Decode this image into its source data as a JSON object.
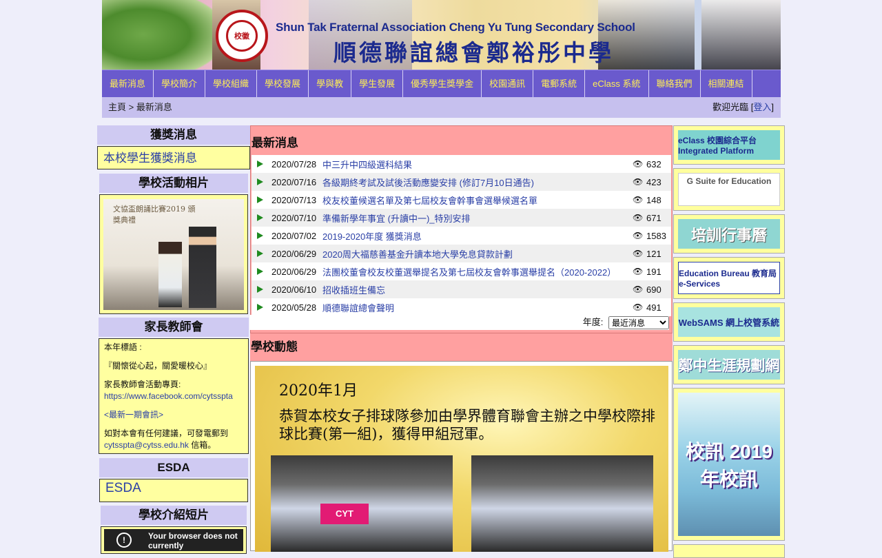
{
  "banner": {
    "title_en": "Shun Tak Fraternal Association Cheng Yu Tung Secondary School",
    "title_zh": "順德聯誼總會鄭裕彤中學"
  },
  "nav": [
    "最新消息",
    "學校簡介",
    "學校組織",
    "學校發展",
    "學與教",
    "學生發展",
    "優秀學生獎學金",
    "校園通訊",
    "電郵系統",
    "eClass 系統",
    "聯絡我們",
    "相關連結"
  ],
  "breadcrumb": {
    "home": "主頁",
    "sep": ">",
    "current": "最新消息"
  },
  "welcome": {
    "text": "歡迎光臨",
    "login": "登入"
  },
  "left": {
    "awards_title": "獲獎消息",
    "awards_link": "本校學生獲獎消息",
    "photos_title": "學校活動相片",
    "photo_caption": "文協盃朗誦比賽2019 頒獎典禮",
    "pta_title": "家長教師會",
    "pta_slogan_label": "本年標語 :",
    "pta_slogan": "『關懷從心起，關愛暖校心』",
    "pta_page_label": "家長教師會活動專頁:",
    "pta_page_url": "https://www.facebook.com/cytsspta",
    "pta_newsletter": "<最新一期會訊>",
    "pta_contact_text": "如對本會有任何建議，可發電郵到",
    "pta_email": "cytsspta@cytss.edu.hk",
    "pta_contact_suffix": " 信箱。",
    "esda_title": "ESDA",
    "esda_link": "ESDA",
    "video_title": "學校介紹短片",
    "video_msg": "Your browser does not currently"
  },
  "news": {
    "title": "最新消息",
    "items": [
      {
        "date": "2020/07/28",
        "title": "中三升中四級選科結果",
        "count": "632"
      },
      {
        "date": "2020/07/16",
        "title": "各級期終考試及試後活動應變安排 (修訂7月10日通告)",
        "count": "423"
      },
      {
        "date": "2020/07/13",
        "title": "校友校董候選名單及第七屆校友會幹事會選舉候選名單",
        "count": "148"
      },
      {
        "date": "2020/07/10",
        "title": "準備新學年事宜 (升讀中一)_特別安排",
        "count": "671"
      },
      {
        "date": "2020/07/02",
        "title": "2019-2020年度 獲獎消息",
        "count": "1583"
      },
      {
        "date": "2020/06/29",
        "title": "2020周大福慈善基金升讀本地大學免息貸款計劃",
        "count": "121"
      },
      {
        "date": "2020/06/29",
        "title": "法團校董會校友校董選舉提名及第七屆校友會幹事選舉提名（2020-2022）",
        "count": "191"
      },
      {
        "date": "2020/06/10",
        "title": "招收插班生備忘",
        "count": "690"
      },
      {
        "date": "2020/05/28",
        "title": "順德聯誼總會聲明",
        "count": "491"
      }
    ],
    "year_label": "年度:",
    "year_selected": "最近消息"
  },
  "dynamics": {
    "title": "學校動態",
    "poster_date": "2020年1月",
    "poster_text": "恭賀本校女子排球隊參加由學界體育聯會主辦之中學校際排球比賽(第一組)，獲得甲組冠軍。",
    "team_banner": "CYT"
  },
  "right": [
    {
      "label": "eClass 校園綜合平台 Integrated Platform",
      "bg": "#7fd3cf"
    },
    {
      "label": "G Suite for Education",
      "bg": "#ffffff"
    },
    {
      "label": "培訓行事曆",
      "bg": "#8fd6d2"
    },
    {
      "label": "Education Bureau 教育局 e-Services",
      "bg": "#ffffff"
    },
    {
      "label": "WebSAMS 網上校管系統",
      "bg": "#a8e3e0"
    },
    {
      "label": "鄭中生涯規劃網",
      "bg": "#9fdcd8"
    },
    {
      "label": "校訊 2019年校訊",
      "bg": "#6ec9c4"
    }
  ]
}
